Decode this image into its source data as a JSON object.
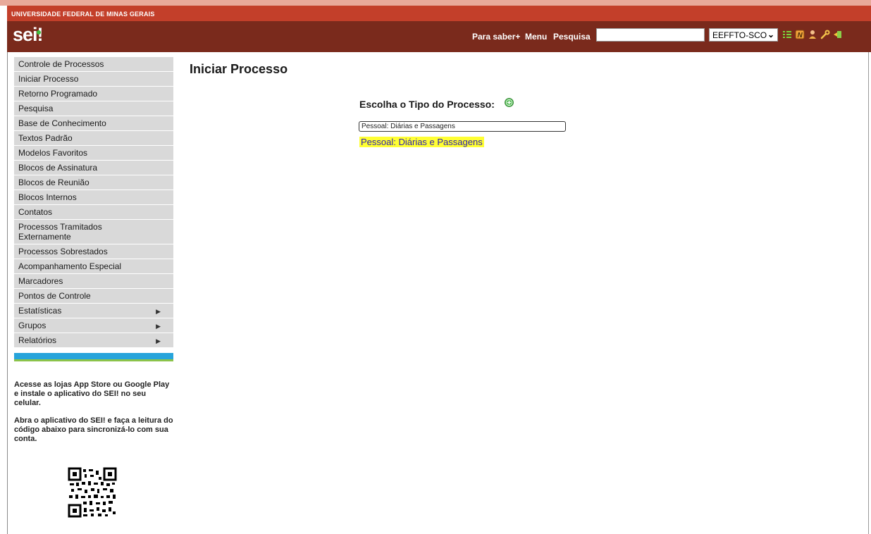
{
  "header": {
    "institution": "UNIVERSIDADE FEDERAL DE MINAS GERAIS",
    "logo": "sei",
    "logo_mark": "!",
    "links": {
      "para_saber": "Para saber+",
      "menu": "Menu",
      "pesquisa": "Pesquisa"
    },
    "search_value": "",
    "unit_selected": "EEFFTO-SCO",
    "toolbar_icons": [
      "list-icon",
      "notes-icon",
      "user-icon",
      "wrench-icon",
      "exit-icon"
    ]
  },
  "sidebar": {
    "items": [
      {
        "label": "Controle de Processos"
      },
      {
        "label": "Iniciar Processo"
      },
      {
        "label": "Retorno Programado"
      },
      {
        "label": "Pesquisa"
      },
      {
        "label": "Base de Conhecimento"
      },
      {
        "label": "Textos Padrão"
      },
      {
        "label": "Modelos Favoritos"
      },
      {
        "label": "Blocos de Assinatura"
      },
      {
        "label": "Blocos de Reunião"
      },
      {
        "label": "Blocos Internos"
      },
      {
        "label": "Contatos"
      },
      {
        "label": "Processos Tramitados Externamente"
      },
      {
        "label": "Processos Sobrestados"
      },
      {
        "label": "Acompanhamento Especial"
      },
      {
        "label": "Marcadores"
      },
      {
        "label": "Pontos de Controle"
      },
      {
        "label": "Estatísticas",
        "submenu": true
      },
      {
        "label": "Grupos",
        "submenu": true
      },
      {
        "label": "Relatórios",
        "submenu": true
      }
    ],
    "promo_1": "Acesse as lojas App Store ou Google Play e instale o aplicativo do SEI! no seu celular.",
    "promo_2": "Abra o aplicativo do SEI! e faça a leitura do código abaixo para sincronizá-lo com sua conta."
  },
  "main": {
    "title": "Iniciar Processo",
    "choose_label": "Escolha o Tipo do Processo:",
    "filter_value": "Pessoal: Diárias e Passagens",
    "options": [
      "Pessoal: Diárias e Passagens"
    ]
  },
  "colors": {
    "header_dark": "#7a2a1c",
    "header_bar": "#c33f2a",
    "menu_bg": "#d9d9d9",
    "highlight": "#ffff33",
    "link": "#2a1fb0"
  }
}
